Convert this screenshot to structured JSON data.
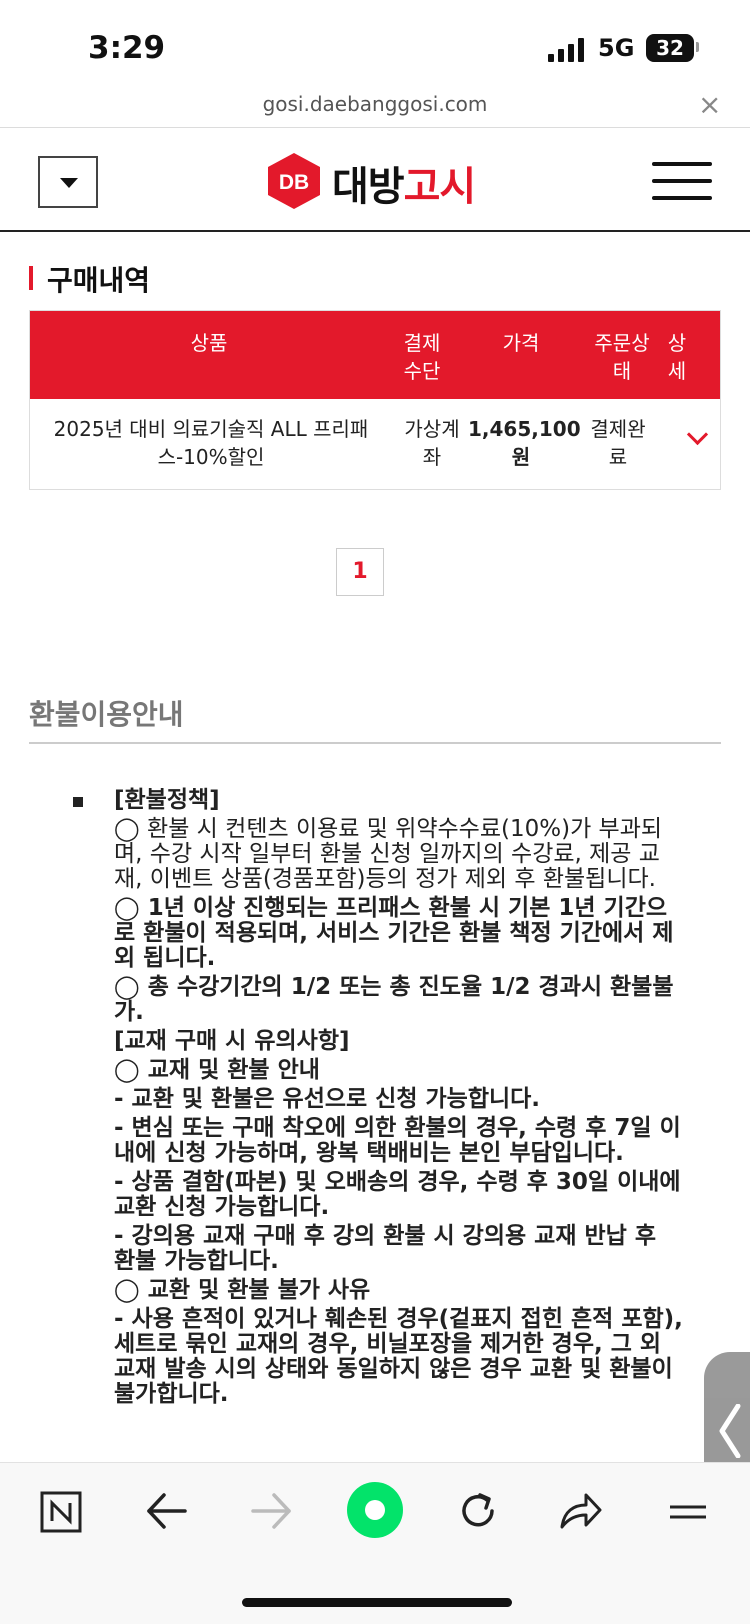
{
  "status_bar": {
    "time": "3:29",
    "network": "5G",
    "battery": "32"
  },
  "browser": {
    "url": "gosi.daebanggosi.com",
    "close_icon": "×"
  },
  "header": {
    "logo_mark": "DB",
    "logo_text_black": "대방",
    "logo_text_red": "고시",
    "brand_color": "#e3192b"
  },
  "purchase": {
    "section_title": "구매내역",
    "columns": [
      "상품",
      "결제수단",
      "가격",
      "주문상태",
      "상세"
    ],
    "rows": [
      {
        "product_line1": "2025년 대비 의료기술직 ALL 프리패",
        "product_line2": "스-10%할인",
        "payment_line1": "가상계",
        "payment_line2": "좌",
        "price": "1,465,100",
        "price_unit": "원",
        "status_line1": "결제완",
        "status_line2": "료"
      }
    ]
  },
  "pagination": {
    "current_page": "1"
  },
  "refund": {
    "title": "환불이용안내",
    "lines": [
      {
        "text": "[환불정책]",
        "bold": true
      },
      {
        "text": "◯ 환불 시 컨텐츠 이용료 및 위약수수료(10%)가 부과되며, 수강 시작 일부터 환불 신청 일까지의 수강료, 제공 교재, 이벤트 상품(경품포함)등의 정가 제외 후 환불됩니다.",
        "bold": false
      },
      {
        "text": "◯ 1년 이상 진행되는 프리패스 환불 시 기본 1년 기간으로 환불이 적용되며, 서비스 기간은 환불 책정 기간에서 제외 됩니다.",
        "bold": true
      },
      {
        "text": "◯ 총 수강기간의 1/2 또는 총 진도율 1/2 경과시 환불불가.",
        "bold": true
      },
      {
        "text": "[교재 구매 시 유의사항]",
        "bold": true
      },
      {
        "text": "◯ 교재 및 환불 안내",
        "bold": true
      },
      {
        "text": "- 교환 및 환불은 유선으로 신청 가능합니다.",
        "bold": true
      },
      {
        "text": "- 변심 또는 구매 착오에 의한 환불의 경우, 수령 후 7일 이내에 신청 가능하며, 왕복 택배비는 본인 부담입니다.",
        "bold": true
      },
      {
        "text": "- 상품 결함(파본) 및 오배송의 경우, 수령 후 30일 이내에 교환 신청 가능합니다.",
        "bold": true
      },
      {
        "text": "- 강의용 교재 구매 후 강의 환불 시 강의용 교재 반납 후 환불 가능합니다.",
        "bold": true
      },
      {
        "text": "◯ 교환 및 환불 불가 사유",
        "bold": true
      },
      {
        "text": "- 사용 흔적이 있거나 훼손된 경우(겉표지 접힌 흔적 포함), 세트로 묶인 교재의 경우, 비닐포장을 제거한 경우, 그 외 교재 발송 시의 상태와 동일하지 않은 경우 교환 및 환불이 불가합니다.",
        "bold": true
      }
    ]
  },
  "toolbar": {
    "icons": [
      "naver-n-icon",
      "back-arrow-icon",
      "forward-arrow-icon",
      "green-dot-icon",
      "refresh-icon",
      "share-icon",
      "menu-icon"
    ]
  }
}
